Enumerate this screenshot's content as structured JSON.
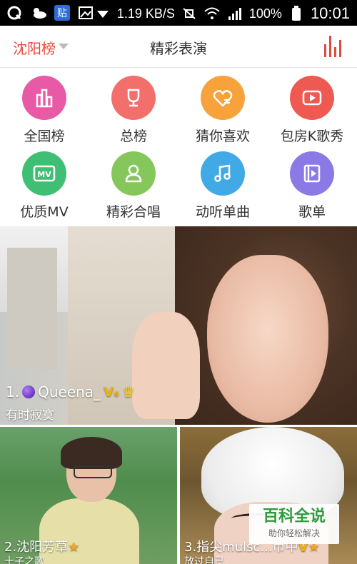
{
  "status_bar": {
    "speed": "1.19 KB/S",
    "battery": "100%",
    "time": "10:01",
    "tie_badge": "贴"
  },
  "header": {
    "city": "沈阳榜",
    "title": "精彩表演"
  },
  "categories": [
    {
      "label": "全国榜",
      "color": "#e85aa6",
      "icon": "chart-bars-icon"
    },
    {
      "label": "总榜",
      "color": "#f26f6b",
      "icon": "trophy-icon"
    },
    {
      "label": "猜你喜欢",
      "color": "#f8a23b",
      "icon": "heart-list-icon"
    },
    {
      "label": "包房K歌秀",
      "color": "#ee5a52",
      "icon": "play-tv-icon"
    },
    {
      "label": "优质MV",
      "color": "#3fbf74",
      "icon": "mv-icon"
    },
    {
      "label": "精彩合唱",
      "color": "#86c75c",
      "icon": "duet-icon"
    },
    {
      "label": "动听单曲",
      "color": "#41a9e6",
      "icon": "music-note-icon"
    },
    {
      "label": "歌单",
      "color": "#8b79e6",
      "icon": "playlist-icon"
    }
  ],
  "hero": {
    "rank_name": "1.",
    "name": "Queena_",
    "name_suffix": "",
    "vip": "V₆",
    "song": "有时寂寞"
  },
  "cards": [
    {
      "title": "2.沈阳芳草",
      "song": "十子之歌"
    },
    {
      "title": "3.指尖mulsc...币中",
      "song": "放过自己"
    }
  ],
  "watermark": {
    "main": "百科全说",
    "sub": "助你轻松解决"
  }
}
